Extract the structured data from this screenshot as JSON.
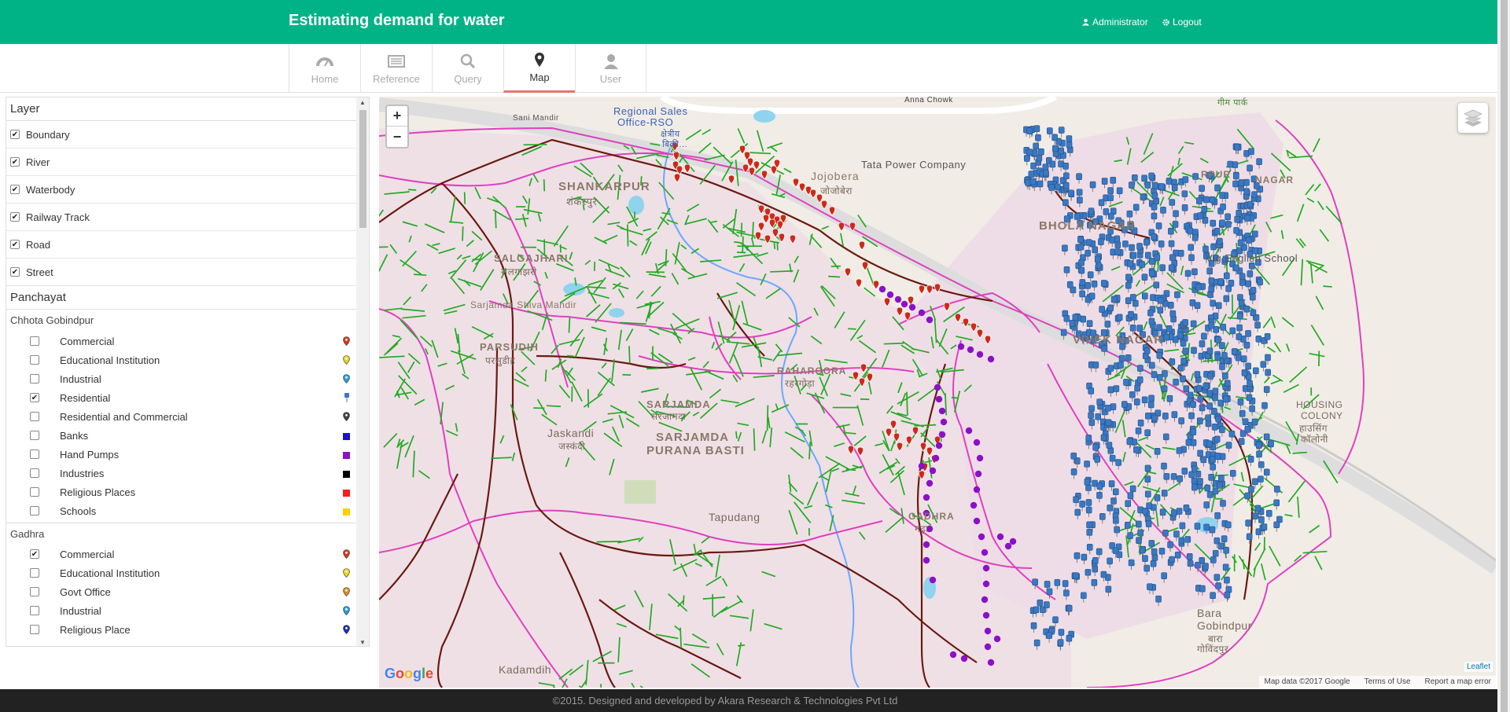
{
  "header": {
    "title": "Estimating demand for water",
    "admin_label": "Administrator",
    "logout_label": "Logout"
  },
  "nav": {
    "tabs": [
      {
        "label": "Home",
        "icon": "dashboard-icon"
      },
      {
        "label": "Reference",
        "icon": "list-icon"
      },
      {
        "label": "Query",
        "icon": "search-icon"
      },
      {
        "label": "Map",
        "icon": "map-marker-icon",
        "active": true
      },
      {
        "label": "User",
        "icon": "user-icon"
      }
    ]
  },
  "panel": {
    "layer_heading": "Layer",
    "layers": [
      {
        "label": "Boundary",
        "checked": true
      },
      {
        "label": "River",
        "checked": true
      },
      {
        "label": "Waterbody",
        "checked": true
      },
      {
        "label": "Railway Track",
        "checked": true
      },
      {
        "label": "Road",
        "checked": true
      },
      {
        "label": "Street",
        "checked": true
      }
    ],
    "panchayat_heading": "Panchayat",
    "groups": [
      {
        "name": "Chhota Gobindpur",
        "items": [
          {
            "label": "Commercial",
            "checked": false,
            "legend": "marker",
            "color": "#d9381e"
          },
          {
            "label": "Educational Institution",
            "checked": false,
            "legend": "marker",
            "color": "#e5d418"
          },
          {
            "label": "Industrial",
            "checked": false,
            "legend": "marker",
            "color": "#2a9fd8"
          },
          {
            "label": "Residential",
            "checked": true,
            "legend": "pin",
            "color": "#3a78c2"
          },
          {
            "label": "Residential and Commercial",
            "checked": false,
            "legend": "marker",
            "color": "#444444"
          },
          {
            "label": "Banks",
            "checked": false,
            "legend": "square",
            "color": "#1a14c8"
          },
          {
            "label": "Hand Pumps",
            "checked": false,
            "legend": "square",
            "color": "#8c10c8"
          },
          {
            "label": "Industries",
            "checked": false,
            "legend": "square",
            "color": "#000000"
          },
          {
            "label": "Religious Places",
            "checked": false,
            "legend": "square",
            "color": "#ff1a1a"
          },
          {
            "label": "Schools",
            "checked": false,
            "legend": "square",
            "color": "#ffd000"
          }
        ]
      },
      {
        "name": "Gadhra",
        "items": [
          {
            "label": "Commercial",
            "checked": true,
            "legend": "marker",
            "color": "#d9381e"
          },
          {
            "label": "Educational Institution",
            "checked": false,
            "legend": "marker",
            "color": "#e5d418"
          },
          {
            "label": "Govt Office",
            "checked": false,
            "legend": "marker",
            "color": "#e08a1a"
          },
          {
            "label": "Industrial",
            "checked": false,
            "legend": "marker",
            "color": "#2a9fd8"
          },
          {
            "label": "Religious Place",
            "checked": false,
            "legend": "marker",
            "color": "#1a2fb8"
          }
        ]
      }
    ]
  },
  "map": {
    "zoom_in": "+",
    "zoom_out": "−",
    "labels": {
      "anna_chowk": "Anna Chowk",
      "sani_mandir": "Sani Mandir",
      "regional_sales": "Regional Sales",
      "office_rso": "Office-RSO",
      "kshetriya": "क्षेत्रीय",
      "bikri": "बिक्री...",
      "tata_power": "Tata Power Company",
      "jojobera": "Jojobera",
      "jojobera_hi": "जोजोबेरा",
      "shankarpur": "SHANKARPUR",
      "shankarpur_hi": "शंकरपुर",
      "bhola_nagar": "BHOLA NAGAR",
      "vig_english": "Vig English School",
      "vivek_nagar": "VIVEK NAGAR",
      "housing_colony": "HOUSING",
      "housing_colony2": "COLONY",
      "housing_colony_hi": "हाउसिंग",
      "housing_colony_hi2": "कॉलोनी",
      "salgajhari": "SALGAJHARI",
      "salgajhari_hi": "सलगाझरी",
      "sarjamda_shiva": "Sarjamda Shiva Mandir",
      "parsudih": "PARSUDIH",
      "parsudih_hi": "परसुडीह",
      "rahargora": "RAHARGORA",
      "rahargora_hi": "रहरगोड़ा",
      "sarjamda": "SARJAMDA",
      "sarjamda_hi": "सरजामदा",
      "jaskandi": "Jaskandi",
      "jaskandi_hi": "जस्कंदी",
      "sarjamda_purana": "SARJAMDA",
      "purana_basti": "PURANA BASTI",
      "tapudang": "Tapudang",
      "gadhra": "GADHRA",
      "gadhra_hi": "गढ़ा",
      "bara_gobindpur": "Bara",
      "bara_gobindpur2": "Gobindpur",
      "bara_hi": "बारा",
      "gobindpur_hi": "गोविंदपुर",
      "kadamdih": "Kadamdih",
      "nagar_top": "NAGAR",
      "rpur_top": "RPUR",
      "ghim_park": "गीम पार्क"
    },
    "google": "Google",
    "leaflet": "Leaflet",
    "map_data": "Map data ©2017 Google",
    "terms": "Terms of Use",
    "report": "Report a map error"
  },
  "footer": {
    "text": "©2015. Designed and developed by Akara Research & Technologies Pvt Ltd"
  },
  "colors": {
    "brand": "#00b386",
    "active_tab_underline": "#e6746a",
    "boundary": "#e040c0",
    "street": "#22aa22",
    "road": "#6b1a10",
    "river": "#6aa8ff"
  }
}
